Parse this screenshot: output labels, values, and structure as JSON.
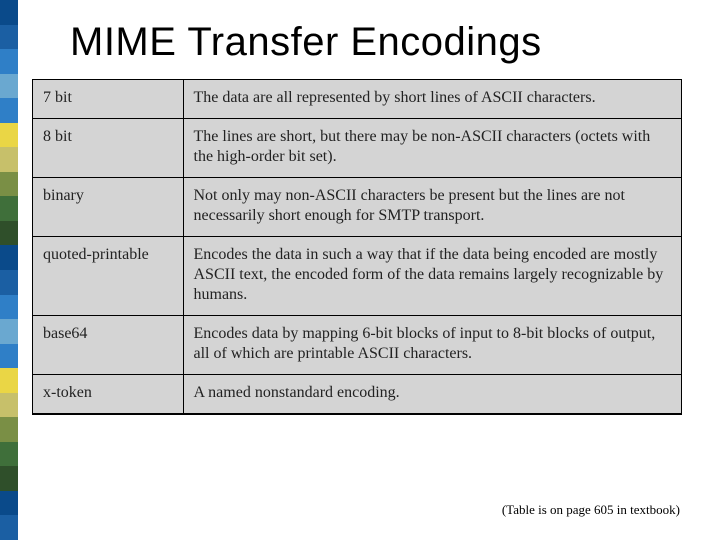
{
  "title": "MIME Transfer Encodings",
  "stripe_colors": [
    "#0a4a8a",
    "#1b5fa3",
    "#2f7fc7",
    "#6aa8d0",
    "#2f7fc7",
    "#ead645",
    "#c7c06a",
    "#7a8f45",
    "#3f6f3a",
    "#2f4f2a",
    "#0a4a8a",
    "#1b5fa3",
    "#2f7fc7",
    "#6aa8d0",
    "#2f7fc7",
    "#ead645",
    "#c7c06a",
    "#7a8f45",
    "#3f6f3a",
    "#2f4f2a",
    "#0a4a8a",
    "#1b5fa3"
  ],
  "rows": [
    {
      "name": "7 bit",
      "desc": "The data are all represented by short lines of ASCII characters."
    },
    {
      "name": "8 bit",
      "desc": "The lines are short, but there may be non-ASCII characters (octets with the high-order bit set)."
    },
    {
      "name": "binary",
      "desc": "Not only may non-ASCII characters be present but the lines are not necessarily short enough for SMTP transport."
    },
    {
      "name": "quoted-printable",
      "desc": "Encodes the data in such a way that if the data being encoded are mostly ASCII text, the encoded form of the data remains largely recognizable by humans."
    },
    {
      "name": "base64",
      "desc": "Encodes data by mapping 6-bit blocks of input to 8-bit blocks of output, all of which are printable ASCII characters."
    },
    {
      "name": "x-token",
      "desc": "A named nonstandard encoding."
    }
  ],
  "footnote": "(Table is on page 605 in textbook)"
}
